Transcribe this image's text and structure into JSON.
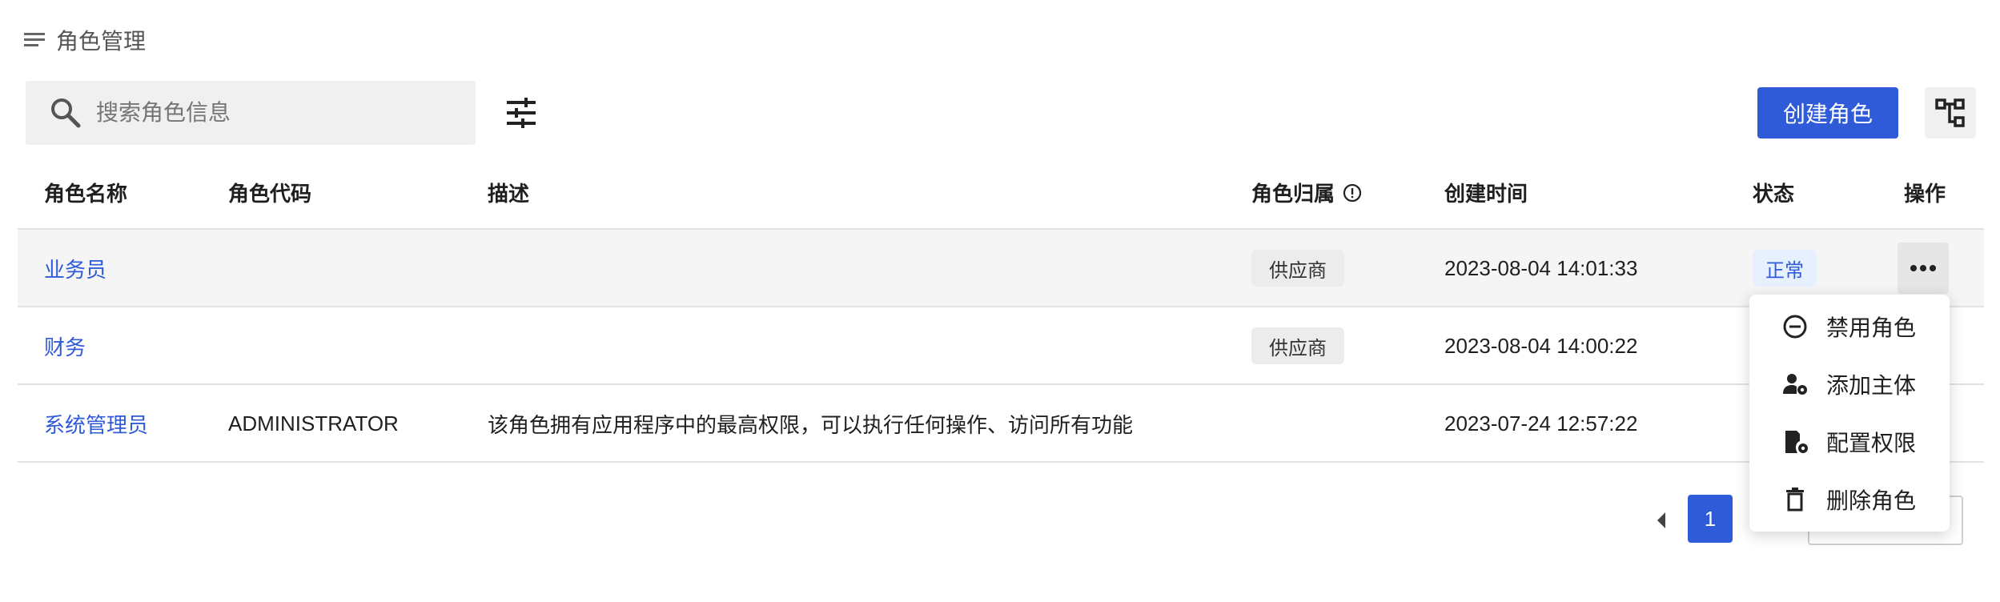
{
  "page": {
    "title": "角色管理",
    "title_icon": "menu-icon"
  },
  "toolbar": {
    "search_placeholder": "搜索角色信息",
    "search_icon": "search-icon",
    "filter_icon": "tune-icon",
    "create_label": "创建角色",
    "tree_icon": "hierarchy-icon"
  },
  "table": {
    "columns": [
      "角色名称",
      "角色代码",
      "描述",
      "角色归属",
      "创建时间",
      "状态",
      "操作"
    ],
    "owner_info_icon": "info-icon",
    "rows": [
      {
        "name": "业务员",
        "code": "",
        "description": "",
        "owner": "供应商",
        "created": "2023-08-04 14:01:33",
        "status": "正常"
      },
      {
        "name": "财务",
        "code": "",
        "description": "",
        "owner": "供应商",
        "created": "2023-08-04 14:00:22",
        "status": ""
      },
      {
        "name": "系统管理员",
        "code": "ADMINISTRATOR",
        "description": "该角色拥有应用程序中的最高权限，可以执行任何操作、访问所有功能",
        "owner": "",
        "created": "2023-07-24 12:57:22",
        "status": ""
      }
    ]
  },
  "action_menu": {
    "items": [
      {
        "label": "禁用角色",
        "icon": "minus-circle-icon"
      },
      {
        "label": "添加主体",
        "icon": "user-cog-icon"
      },
      {
        "label": "配置权限",
        "icon": "lock-settings-icon"
      },
      {
        "label": "删除角色",
        "icon": "trash-icon"
      }
    ]
  },
  "pagination": {
    "current_page": "1"
  },
  "colors": {
    "accent": "#2f5bd8",
    "status_bg": "#e7f0ff",
    "tag_bg": "#ececec",
    "row_hover": "#f5f5f5"
  }
}
